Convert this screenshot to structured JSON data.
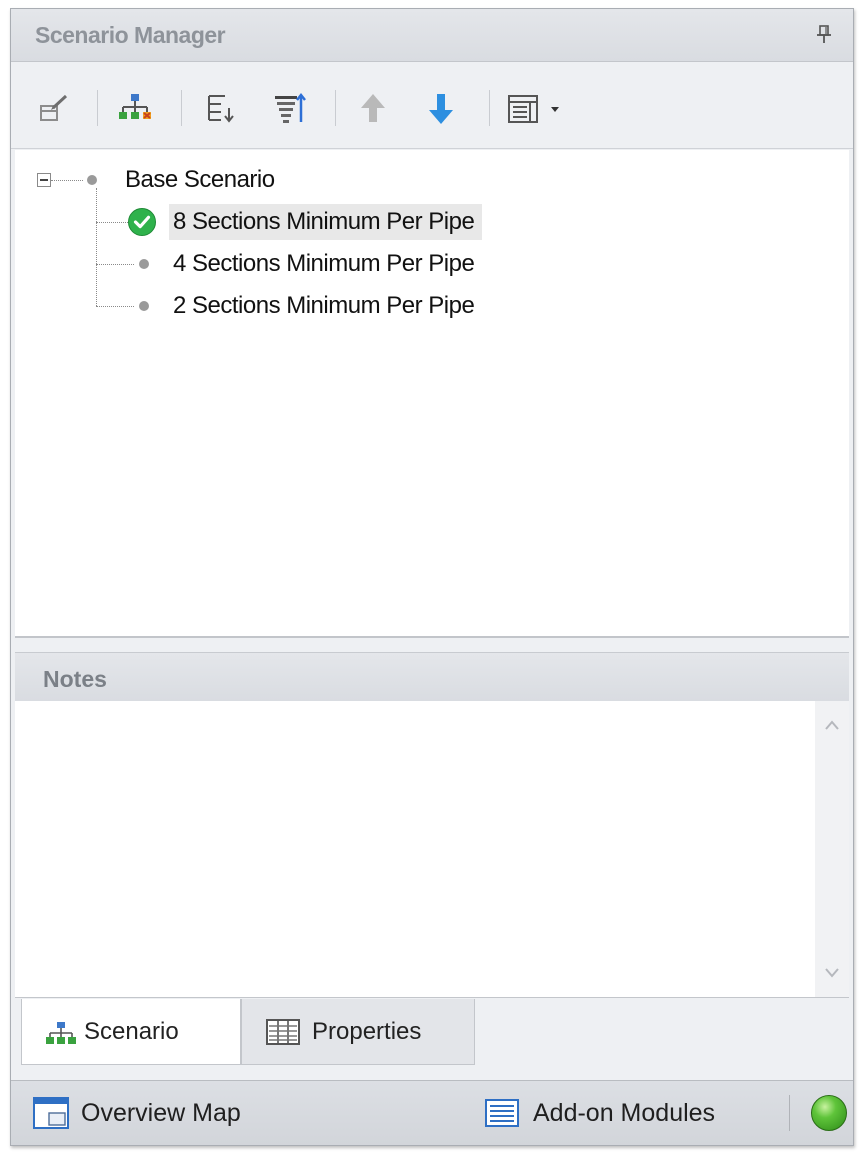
{
  "panel": {
    "title": "Scenario Manager"
  },
  "toolbar": {
    "icons": [
      "edit-scenario-icon",
      "tree-view-icon",
      "sort-icon",
      "filter-sort-icon",
      "move-up-icon",
      "move-down-icon",
      "view-options-icon"
    ]
  },
  "tree": {
    "root": "Base Scenario",
    "children": [
      {
        "label": "8 Sections Minimum Per Pipe",
        "status": "current"
      },
      {
        "label": "4 Sections Minimum Per Pipe",
        "status": "none"
      },
      {
        "label": "2 Sections Minimum Per Pipe",
        "status": "none"
      }
    ]
  },
  "notes": {
    "title": "Notes",
    "text": ""
  },
  "tabs": {
    "scenario": "Scenario",
    "properties": "Properties"
  },
  "status": {
    "overview": "Overview Map",
    "addons": "Add-on Modules"
  },
  "colors": {
    "check_green": "#2fb24c",
    "arrow_blue": "#2d8fe0",
    "status_led": "#5fc43a"
  }
}
